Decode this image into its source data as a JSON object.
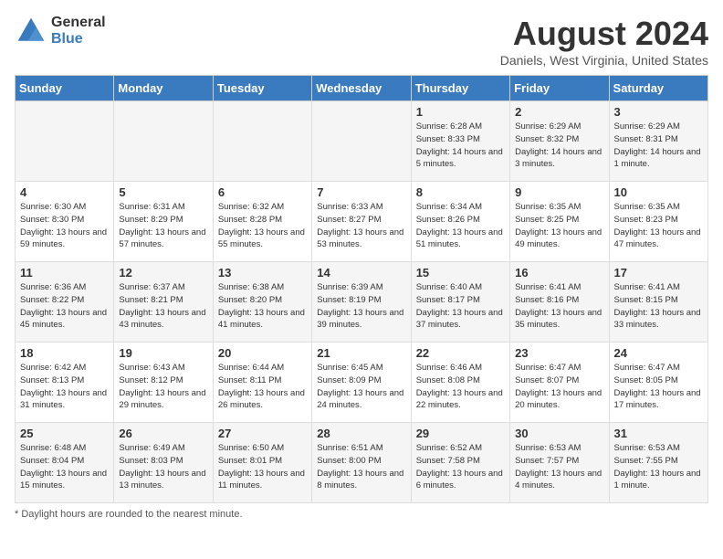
{
  "header": {
    "logo_general": "General",
    "logo_blue": "Blue",
    "title": "August 2024",
    "location": "Daniels, West Virginia, United States"
  },
  "columns": [
    "Sunday",
    "Monday",
    "Tuesday",
    "Wednesday",
    "Thursday",
    "Friday",
    "Saturday"
  ],
  "weeks": [
    [
      {
        "day": "",
        "info": ""
      },
      {
        "day": "",
        "info": ""
      },
      {
        "day": "",
        "info": ""
      },
      {
        "day": "",
        "info": ""
      },
      {
        "day": "1",
        "info": "Sunrise: 6:28 AM\nSunset: 8:33 PM\nDaylight: 14 hours and 5 minutes."
      },
      {
        "day": "2",
        "info": "Sunrise: 6:29 AM\nSunset: 8:32 PM\nDaylight: 14 hours and 3 minutes."
      },
      {
        "day": "3",
        "info": "Sunrise: 6:29 AM\nSunset: 8:31 PM\nDaylight: 14 hours and 1 minute."
      }
    ],
    [
      {
        "day": "4",
        "info": "Sunrise: 6:30 AM\nSunset: 8:30 PM\nDaylight: 13 hours and 59 minutes."
      },
      {
        "day": "5",
        "info": "Sunrise: 6:31 AM\nSunset: 8:29 PM\nDaylight: 13 hours and 57 minutes."
      },
      {
        "day": "6",
        "info": "Sunrise: 6:32 AM\nSunset: 8:28 PM\nDaylight: 13 hours and 55 minutes."
      },
      {
        "day": "7",
        "info": "Sunrise: 6:33 AM\nSunset: 8:27 PM\nDaylight: 13 hours and 53 minutes."
      },
      {
        "day": "8",
        "info": "Sunrise: 6:34 AM\nSunset: 8:26 PM\nDaylight: 13 hours and 51 minutes."
      },
      {
        "day": "9",
        "info": "Sunrise: 6:35 AM\nSunset: 8:25 PM\nDaylight: 13 hours and 49 minutes."
      },
      {
        "day": "10",
        "info": "Sunrise: 6:35 AM\nSunset: 8:23 PM\nDaylight: 13 hours and 47 minutes."
      }
    ],
    [
      {
        "day": "11",
        "info": "Sunrise: 6:36 AM\nSunset: 8:22 PM\nDaylight: 13 hours and 45 minutes."
      },
      {
        "day": "12",
        "info": "Sunrise: 6:37 AM\nSunset: 8:21 PM\nDaylight: 13 hours and 43 minutes."
      },
      {
        "day": "13",
        "info": "Sunrise: 6:38 AM\nSunset: 8:20 PM\nDaylight: 13 hours and 41 minutes."
      },
      {
        "day": "14",
        "info": "Sunrise: 6:39 AM\nSunset: 8:19 PM\nDaylight: 13 hours and 39 minutes."
      },
      {
        "day": "15",
        "info": "Sunrise: 6:40 AM\nSunset: 8:17 PM\nDaylight: 13 hours and 37 minutes."
      },
      {
        "day": "16",
        "info": "Sunrise: 6:41 AM\nSunset: 8:16 PM\nDaylight: 13 hours and 35 minutes."
      },
      {
        "day": "17",
        "info": "Sunrise: 6:41 AM\nSunset: 8:15 PM\nDaylight: 13 hours and 33 minutes."
      }
    ],
    [
      {
        "day": "18",
        "info": "Sunrise: 6:42 AM\nSunset: 8:13 PM\nDaylight: 13 hours and 31 minutes."
      },
      {
        "day": "19",
        "info": "Sunrise: 6:43 AM\nSunset: 8:12 PM\nDaylight: 13 hours and 29 minutes."
      },
      {
        "day": "20",
        "info": "Sunrise: 6:44 AM\nSunset: 8:11 PM\nDaylight: 13 hours and 26 minutes."
      },
      {
        "day": "21",
        "info": "Sunrise: 6:45 AM\nSunset: 8:09 PM\nDaylight: 13 hours and 24 minutes."
      },
      {
        "day": "22",
        "info": "Sunrise: 6:46 AM\nSunset: 8:08 PM\nDaylight: 13 hours and 22 minutes."
      },
      {
        "day": "23",
        "info": "Sunrise: 6:47 AM\nSunset: 8:07 PM\nDaylight: 13 hours and 20 minutes."
      },
      {
        "day": "24",
        "info": "Sunrise: 6:47 AM\nSunset: 8:05 PM\nDaylight: 13 hours and 17 minutes."
      }
    ],
    [
      {
        "day": "25",
        "info": "Sunrise: 6:48 AM\nSunset: 8:04 PM\nDaylight: 13 hours and 15 minutes."
      },
      {
        "day": "26",
        "info": "Sunrise: 6:49 AM\nSunset: 8:03 PM\nDaylight: 13 hours and 13 minutes."
      },
      {
        "day": "27",
        "info": "Sunrise: 6:50 AM\nSunset: 8:01 PM\nDaylight: 13 hours and 11 minutes."
      },
      {
        "day": "28",
        "info": "Sunrise: 6:51 AM\nSunset: 8:00 PM\nDaylight: 13 hours and 8 minutes."
      },
      {
        "day": "29",
        "info": "Sunrise: 6:52 AM\nSunset: 7:58 PM\nDaylight: 13 hours and 6 minutes."
      },
      {
        "day": "30",
        "info": "Sunrise: 6:53 AM\nSunset: 7:57 PM\nDaylight: 13 hours and 4 minutes."
      },
      {
        "day": "31",
        "info": "Sunrise: 6:53 AM\nSunset: 7:55 PM\nDaylight: 13 hours and 1 minute."
      }
    ]
  ],
  "footer": "Daylight hours"
}
